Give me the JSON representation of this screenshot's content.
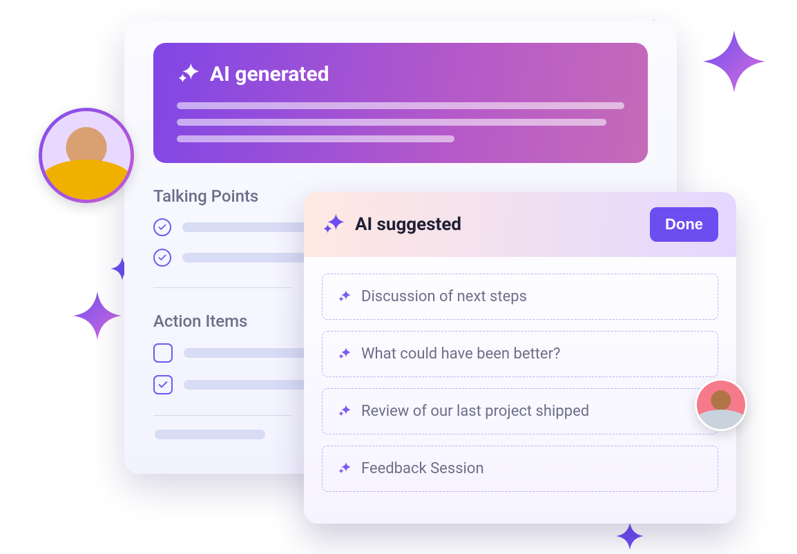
{
  "back_card": {
    "ai_generated": {
      "title": "AI generated"
    },
    "talking_points": {
      "title": "Talking Points"
    },
    "action_items": {
      "title": "Action Items"
    }
  },
  "front_card": {
    "title": "AI suggested",
    "done_label": "Done",
    "suggestions": [
      "Discussion of next steps",
      "What could have been better?",
      "Review of our last project shipped",
      "Feedback Session"
    ]
  }
}
